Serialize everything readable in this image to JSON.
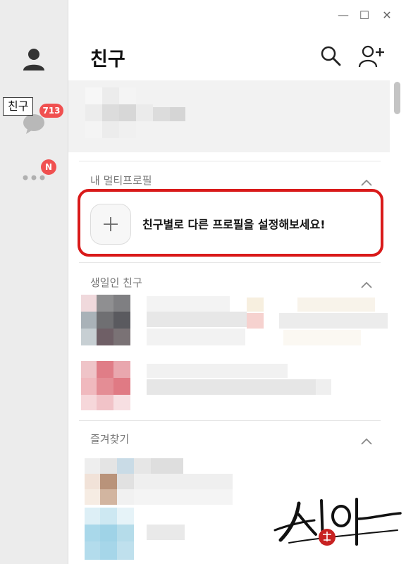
{
  "sidebar": {
    "tooltip": "친구",
    "chat_badge": "713",
    "more_badge": "N",
    "items": [
      {
        "name": "friends",
        "icon": "person-icon"
      },
      {
        "name": "chats",
        "icon": "chat-bubble-icon"
      },
      {
        "name": "more",
        "icon": "more-dots-icon"
      }
    ]
  },
  "window_controls": {
    "minimize": "—",
    "maximize": "☐",
    "close": "✕"
  },
  "header": {
    "title": "친구",
    "search_icon": "search-icon",
    "add_friend_icon": "add-friend-icon"
  },
  "sections": {
    "multi_profile": {
      "title": "내 멀티프로필",
      "add_label": "친구별로 다른 프로필을 설정해보세요!"
    },
    "birthday": {
      "title": "생일인 친구"
    },
    "favorites": {
      "title": "즐겨찾기"
    }
  },
  "colors": {
    "accent_red": "#d91a1a",
    "badge_red": "#f05050",
    "sidebar_bg": "#ececec"
  }
}
